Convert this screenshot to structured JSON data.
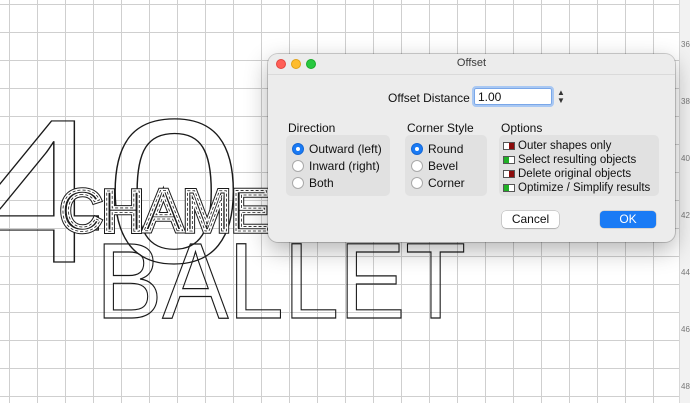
{
  "canvas": {
    "art_big_number": "40",
    "art_word_1": "CHAME",
    "art_word_2": "BALLET"
  },
  "ruler": {
    "labels": [
      "36",
      "38",
      "40",
      "42",
      "44",
      "46",
      "48"
    ]
  },
  "dialog": {
    "title": "Offset",
    "offset_distance_label": "Offset Distance",
    "offset_distance_value": "1.00",
    "direction": {
      "title": "Direction",
      "options": [
        "Outward (left)",
        "Inward (right)",
        "Both"
      ],
      "selected": "Outward (left)"
    },
    "corner_style": {
      "title": "Corner Style",
      "options": [
        "Round",
        "Bevel",
        "Corner"
      ],
      "selected": "Round"
    },
    "options": {
      "title": "Options",
      "items": [
        {
          "label": "Outer shapes only",
          "enabled": false
        },
        {
          "label": "Select resulting objects",
          "enabled": true
        },
        {
          "label": "Delete original objects",
          "enabled": false
        },
        {
          "label": "Optimize / Simplify results",
          "enabled": true
        }
      ]
    },
    "buttons": {
      "cancel": "Cancel",
      "ok": "OK"
    }
  },
  "colors": {
    "accent": "#1a7bf5",
    "toggle_on": "#21b026",
    "toggle_off": "#8b0b0b"
  }
}
